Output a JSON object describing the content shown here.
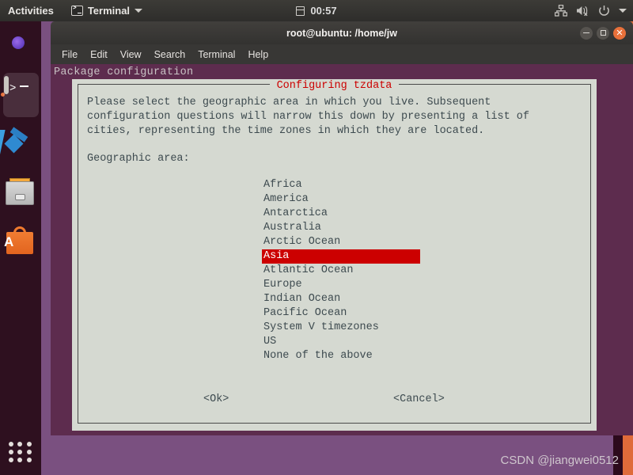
{
  "topbar": {
    "activities": "Activities",
    "app_name": "Terminal",
    "app_icon": "terminal-icon",
    "clock": "00:57",
    "calendar_icon": "calendar-icon",
    "tray_icons": [
      "network-icon",
      "volume-muted-icon",
      "power-icon",
      "chevron-down-icon"
    ]
  },
  "dock": {
    "items": [
      {
        "name": "firefox",
        "label": "Firefox"
      },
      {
        "name": "terminal",
        "label": "Terminal",
        "active": true
      },
      {
        "name": "vscode",
        "label": "Visual Studio Code"
      },
      {
        "name": "files",
        "label": "Files"
      },
      {
        "name": "ubuntu-software",
        "label": "Ubuntu Software",
        "badge": "A"
      }
    ],
    "show_apps_label": "Show Applications"
  },
  "window": {
    "title": "root@ubuntu: /home/jw",
    "menu": [
      "File",
      "Edit",
      "View",
      "Search",
      "Terminal",
      "Help"
    ],
    "controls": {
      "minimize": "minimize-icon",
      "maximize": "maximize-icon",
      "close": "close-icon"
    }
  },
  "terminal": {
    "header": "Package configuration"
  },
  "dialog": {
    "title": "Configuring tzdata",
    "body": "Please select the geographic area in which you live. Subsequent\nconfiguration questions will narrow this down by presenting a list of\ncities, representing the time zones in which they are located.",
    "field_label": "Geographic area:",
    "options": [
      "Africa",
      "America",
      "Antarctica",
      "Australia",
      "Arctic Ocean",
      "Asia",
      "Atlantic Ocean",
      "Europe",
      "Indian Ocean",
      "Pacific Ocean",
      "System V timezones",
      "US",
      "None of the above"
    ],
    "selected_index": 5,
    "ok_label": "<Ok>",
    "cancel_label": "<Cancel>",
    "highlight_color": "#cc0000",
    "background_color": "#d5d9d1",
    "title_color": "#cc0000"
  },
  "watermark": "CSDN @jiangwei0512"
}
